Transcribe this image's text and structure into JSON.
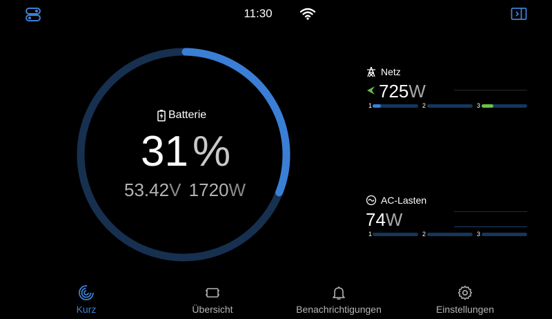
{
  "status_bar": {
    "time": "11:30"
  },
  "battery": {
    "label": "Batterie",
    "percent": "31",
    "percent_unit": "%",
    "level_fraction": 0.31,
    "voltage": "53.42",
    "voltage_unit": "V",
    "power": "1720",
    "power_unit": "W"
  },
  "grid": {
    "label": "Netz",
    "value": "725",
    "unit": "W",
    "phases": [
      {
        "label": "1",
        "fill_fraction": 0.18,
        "color": "#3a7fd5"
      },
      {
        "label": "2",
        "fill_fraction": 0.0,
        "color": "#3a7fd5"
      },
      {
        "label": "3",
        "fill_fraction": 0.25,
        "color": "#6bbf45"
      }
    ]
  },
  "ac_loads": {
    "label": "AC-Lasten",
    "value": "74",
    "unit": "W",
    "phases": [
      {
        "label": "1",
        "fill_fraction": 0.0,
        "color": "#3a7fd5"
      },
      {
        "label": "2",
        "fill_fraction": 0.0,
        "color": "#3a7fd5"
      },
      {
        "label": "3",
        "fill_fraction": 0.0,
        "color": "#3a7fd5"
      }
    ]
  },
  "nav": {
    "items": [
      {
        "label": "Kurz",
        "icon": "gauge-icon",
        "active": true
      },
      {
        "label": "Übersicht",
        "icon": "overview-icon",
        "active": false
      },
      {
        "label": "Benachrichtigungen",
        "icon": "bell-icon",
        "active": false
      },
      {
        "label": "Einstellungen",
        "icon": "gear-icon",
        "active": false
      }
    ]
  },
  "colors": {
    "accent": "#3d82d6",
    "gauge_track": "#17304f",
    "grid_arrow": "#6bbf45"
  }
}
